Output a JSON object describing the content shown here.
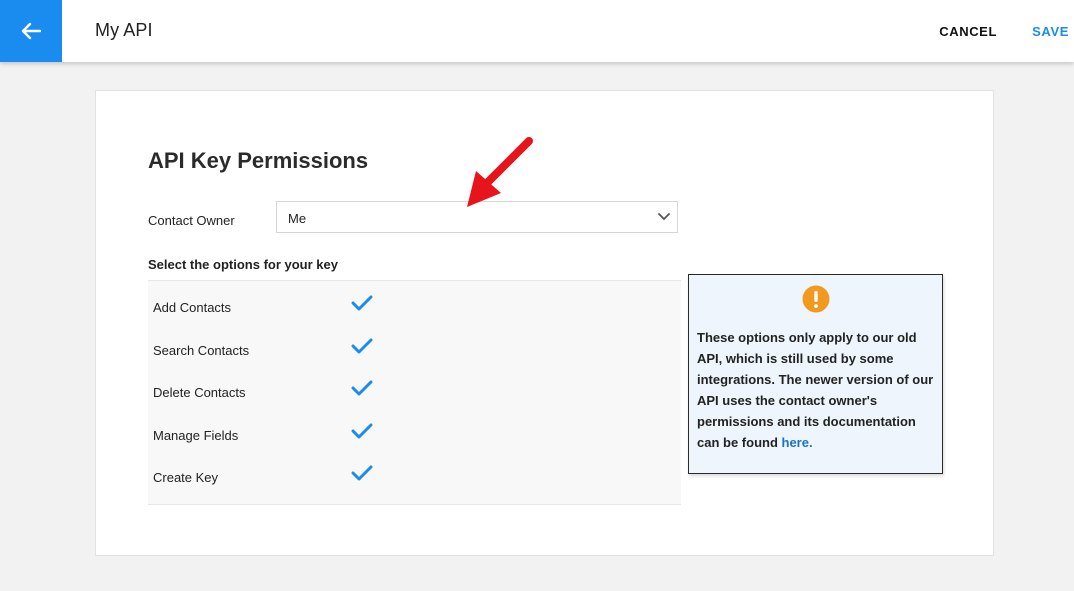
{
  "header": {
    "back_icon": "arrow-left-icon",
    "title": "My API",
    "cancel_label": "CANCEL",
    "save_label": "SAVE",
    "accent_color": "#1a8cf0"
  },
  "permissions": {
    "title": "API Key Permissions",
    "contact_owner": {
      "label": "Contact Owner",
      "selected": "Me",
      "icon": "chevron-down-icon"
    },
    "options_heading": "Select the options for your key",
    "options": [
      {
        "label": "Add Contacts",
        "checked": true
      },
      {
        "label": "Search Contacts",
        "checked": true
      },
      {
        "label": "Delete Contacts",
        "checked": true
      },
      {
        "label": "Manage Fields",
        "checked": true
      },
      {
        "label": "Create Key",
        "checked": true
      }
    ],
    "check_color": "#1a8cf0"
  },
  "info": {
    "icon": "warning-icon",
    "icon_color": "#f29a1f",
    "text": "These options only apply to our old API, which is still used by some integrations. The newer version of our API uses the contact owner's permissions and its documentation can be found ",
    "link_text": "here."
  },
  "annotation": {
    "icon": "red-arrow-icon",
    "color": "#e8141b"
  }
}
